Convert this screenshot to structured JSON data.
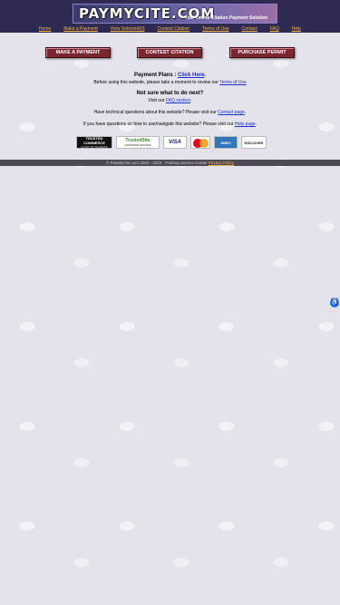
{
  "header": {
    "logo": "PAYMYCITE.COM",
    "tagline": "Your Online Citation Payment Solution",
    "nav": [
      "Home",
      "Make a Payment",
      "View Selected(0)",
      "Contest Citation",
      "Terms of Use",
      "Contact",
      "FAQ",
      "Help"
    ]
  },
  "actions": {
    "make_payment": "MAKE A PAYMENT",
    "contest_citation": "CONTEST CITATION",
    "purchase_permit": "PURCHASE PERMIT"
  },
  "content": {
    "plans_label": "Payment Plans : ",
    "plans_link": "Click Here",
    "plans_suffix": ".",
    "terms_prefix": "Before using this website, please take a moment to review our ",
    "terms_link": "Terms of Use",
    "faq_title": "Not sure what to do next?",
    "faq_prefix": "Visit our ",
    "faq_link": "FAQ section",
    "faq_suffix": ".",
    "contact_prefix": "Have technical questions about this website? Please visit our ",
    "contact_link": "Contact page",
    "contact_suffix": ".",
    "help_prefix": "If you have questions on how to use/navigate this website? Please visit our ",
    "help_link": "Help page",
    "help_suffix": "."
  },
  "badges": {
    "trusted_commerce_top": "TRUSTED",
    "trusted_commerce_bottom": "COMMERCE",
    "trusted_commerce_sub": "CLICK TO VALIDATE",
    "trusted_site": "TrustedSite",
    "trusted_site_sub": "CERTIFIED SECURE",
    "visa": "VISA",
    "amex": "AMEX",
    "discover": "DISCOVER"
  },
  "footer": {
    "text": "© PayMyCite.com 2002 - 2023 · Parking Service Center ",
    "privacy_link": "Privacy Policy"
  },
  "a11y": {
    "icon": "accessibility-icon",
    "glyph": "♿"
  }
}
